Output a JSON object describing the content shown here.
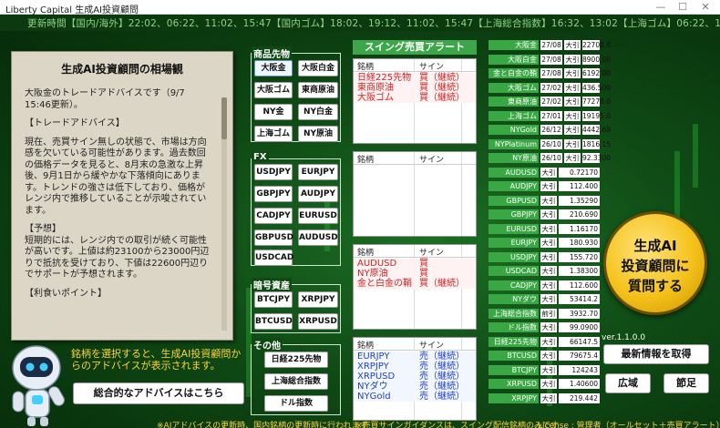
{
  "window": {
    "title": "Liberty Capital 生成AI投資顧問",
    "minimize": "—",
    "maximize": "☐",
    "close": "✕"
  },
  "ticker": "更新時間【国内/海外】22:02、06:22、11:02、15:47【国内ゴム】18:02、19:12、11:02、15:47【上海総合指数】16:32、13:02【上海ゴム】06:22、15:47",
  "advice": {
    "title": "生成AI投資顧問の相場観",
    "paragraphs": [
      "大阪金のトレードアドバイスです（9/7 15:46更新）。",
      "【トレードアドバイス】",
      "現在、売買サイン無しの状態で、市場は方向感を欠いている可能性があります。過去数回の価格データを見ると、8月末の急激な上昇後、9月1日から緩やかな下落傾向にあります。トレンドの強さは低下しており、価格がレンジ内で推移していることが示唆されています。",
      "【予想】\n短期的には、レンジ内での取引が続く可能性が高いです。上値は約23100から23000円辺りで抵抗を受けており、下値は22600円辺りでサポートが予想されます。",
      "【利食いポイント】"
    ]
  },
  "hint": "銘柄を選択すると、生成AI投資顧問からのアドバイスが表示されます。",
  "overall_button": "総合的なアドバイスはこちら",
  "groups": {
    "commodities": {
      "label": "商品先物",
      "buttons": [
        "大阪金",
        "大阪白金",
        "大阪ゴム",
        "東商原油",
        "NY金",
        "NY白金",
        "上海ゴム",
        "NY原油"
      ]
    },
    "fx": {
      "label": "FX",
      "buttons": [
        "USDJPY",
        "EURJPY",
        "GBPJPY",
        "AUDJPY",
        "CADJPY",
        "EURUSD",
        "GBPUSD",
        "AUDUSD",
        "USDCAD"
      ]
    },
    "crypto": {
      "label": "暗号資産",
      "buttons": [
        "BTCJPY",
        "XRPJPY",
        "BTCUSD",
        "XRPUSD"
      ]
    },
    "other": {
      "label": "その他",
      "buttons": [
        "日経225先物",
        "上海総合指数",
        "ドル指数"
      ]
    }
  },
  "swing": {
    "title": "スイング売買アラート",
    "col_name": "銘柄",
    "col_sign": "サイン",
    "box1": [
      [
        "日経225先物",
        "買（継続）"
      ],
      [
        "東商原油",
        "買（継続）"
      ],
      [
        "大阪ゴム",
        "買（継続）"
      ]
    ],
    "box3": [
      [
        "AUDUSD",
        "買"
      ],
      [
        "NY原油",
        "買"
      ],
      [
        "金と白金の鞘",
        "買（継続）"
      ]
    ],
    "box4": [
      [
        "EURJPY",
        "売（継続）"
      ],
      [
        "XRPJPY",
        "売（継続）"
      ],
      [
        "XRPUSD",
        "売（継続）"
      ],
      [
        "NYダウ",
        "売（継続）"
      ],
      [
        "NYGold",
        "売（継続）"
      ]
    ]
  },
  "quotes": [
    [
      "大阪金",
      "27/08",
      "大引",
      "22708.0"
    ],
    [
      "大阪白金",
      "27/08",
      "大引",
      "8900.00"
    ],
    [
      "金と白金の鞘",
      "27/08",
      "大引",
      "6192.00"
    ],
    [
      "大阪ゴム",
      "27/02",
      "大引",
      "436.500"
    ],
    [
      "東商原油",
      "27/02",
      "大引",
      "77270.0"
    ],
    [
      "上海ゴム",
      "27/01",
      "大引",
      "19195.0"
    ],
    [
      "NYGold",
      "26/12",
      "大引",
      "4442.69"
    ],
    [
      "NYPlatinum",
      "26/10",
      "大引",
      "1816.15"
    ],
    [
      "NY原油",
      "26/10",
      "大引",
      "92.3300"
    ],
    [
      "AUDUSD",
      "",
      "大引",
      "0.72170"
    ],
    [
      "AUDJPY",
      "",
      "大引",
      "112.400"
    ],
    [
      "GBPUSD",
      "",
      "大引",
      "1.35290"
    ],
    [
      "GBPJPY",
      "",
      "大引",
      "210.690"
    ],
    [
      "EURUSD",
      "",
      "大引",
      "1.16170"
    ],
    [
      "EURJPY",
      "",
      "大引",
      "180.930"
    ],
    [
      "USDJPY",
      "",
      "大引",
      "155.720"
    ],
    [
      "USDCAD",
      "",
      "大引",
      "1.38300"
    ],
    [
      "CADJPY",
      "",
      "大引",
      "112.600"
    ],
    [
      "NYダウ",
      "",
      "大引",
      "53414.2"
    ],
    [
      "上海総合指数",
      "",
      "前引",
      "3932.70"
    ],
    [
      "ドル指数",
      "",
      "大引",
      "99.0900"
    ],
    [
      "日経225先物",
      "",
      "大引",
      "66147.5"
    ],
    [
      "BTCUSD",
      "",
      "大引",
      "79675.4"
    ],
    [
      "BTCJPY",
      "",
      "大引",
      "124243"
    ],
    [
      "XRPUSD",
      "",
      "大引",
      "1.40600"
    ],
    [
      "XRPJPY",
      "",
      "大引",
      "219.442"
    ]
  ],
  "cta": {
    "line1": "生成AI",
    "line2": "投資顧問に",
    "line3": "質問する"
  },
  "version": "ver.1.1.0.0",
  "buttons": {
    "fetch": "最新情報を取得",
    "wide": "広域",
    "season": "節足"
  },
  "footer": {
    "left": "※AIアドバイスの更新時、国内銘柄の更新時に行われます",
    "mid": "※売買サインガイダンスは、スイング配信銘柄のみです",
    "right": "License : 管理者（オールセット＋売買アラート）"
  },
  "colors": {
    "accent_green": "#39a744",
    "cta_gold": "#f5c21b",
    "sign_red": "#d42020",
    "sign_blue": "#2040d0"
  }
}
